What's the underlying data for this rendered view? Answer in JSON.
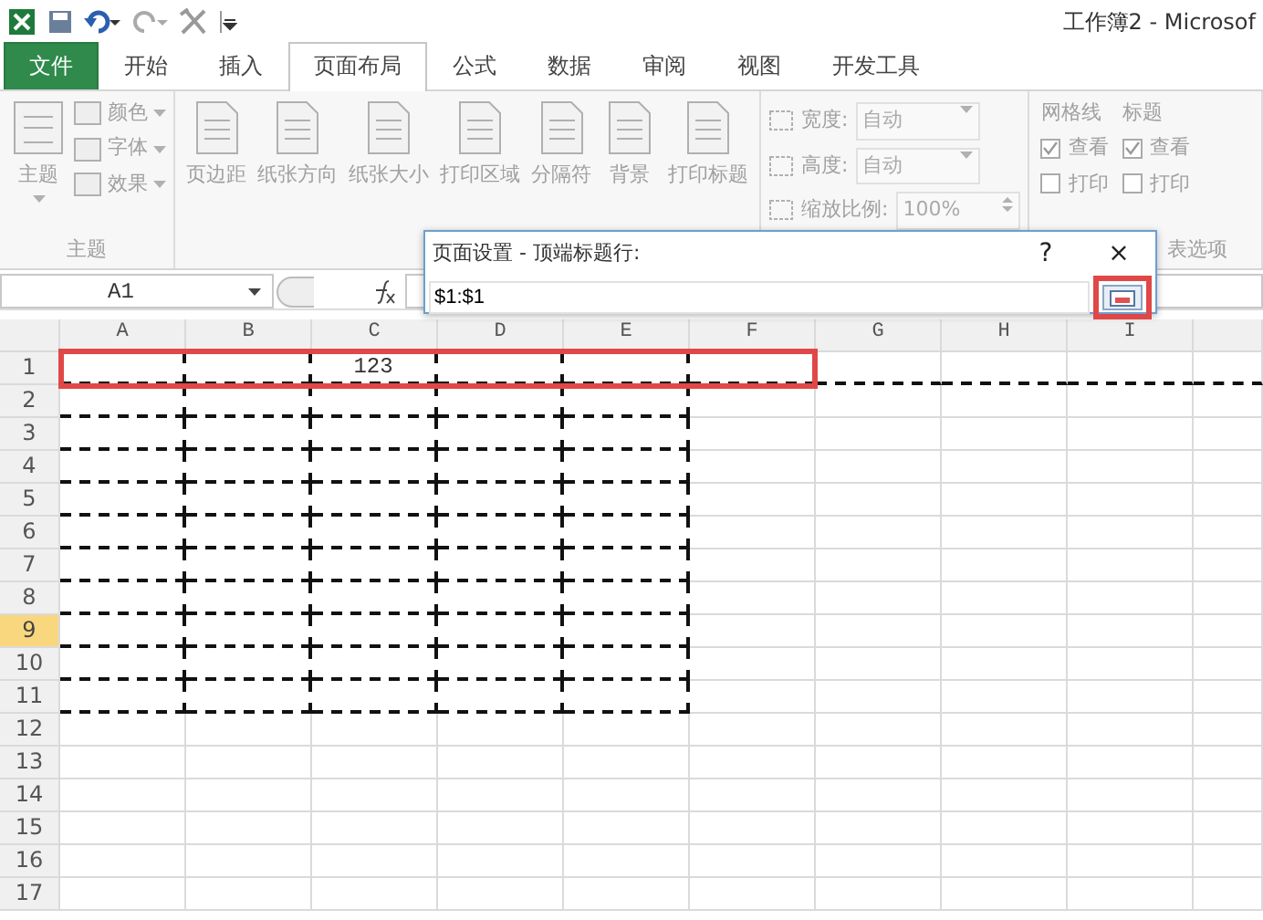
{
  "window": {
    "title": "工作簿2 - Microsof"
  },
  "tabs": [
    {
      "label": "文件",
      "kind": "file",
      "selected": false
    },
    {
      "label": "开始",
      "kind": "tab",
      "selected": false
    },
    {
      "label": "插入",
      "kind": "tab",
      "selected": false
    },
    {
      "label": "页面布局",
      "kind": "tab",
      "selected": true
    },
    {
      "label": "公式",
      "kind": "tab",
      "selected": false
    },
    {
      "label": "数据",
      "kind": "tab",
      "selected": false
    },
    {
      "label": "审阅",
      "kind": "tab",
      "selected": false
    },
    {
      "label": "视图",
      "kind": "tab",
      "selected": false
    },
    {
      "label": "开发工具",
      "kind": "tab",
      "selected": false
    }
  ],
  "ribbon": {
    "disabled": true,
    "groups": [
      {
        "kind": "theme",
        "label": "主题",
        "items": [
          {
            "kind": "large",
            "label": "主题"
          },
          {
            "kind": "small",
            "label": "颜色"
          },
          {
            "kind": "small",
            "label": "字体"
          },
          {
            "kind": "small",
            "label": "效果"
          }
        ]
      },
      {
        "kind": "buttons",
        "items": [
          {
            "label": "页边距"
          },
          {
            "label": "纸张方向"
          },
          {
            "label": "纸张大小"
          },
          {
            "label": "打印区域"
          },
          {
            "label": "分隔符"
          },
          {
            "label": "背景"
          },
          {
            "label": "打印标题"
          }
        ]
      },
      {
        "kind": "scale",
        "items": [
          {
            "kind": "dropdown",
            "label": "宽度:",
            "value": "自动"
          },
          {
            "kind": "dropdown",
            "label": "高度:",
            "value": "自动"
          },
          {
            "kind": "spinner",
            "label": "缩放比例:",
            "value": "100%"
          }
        ]
      },
      {
        "kind": "options",
        "label": "表选项",
        "columns": [
          {
            "heading": "网格线",
            "options": [
              {
                "label": "查看",
                "checked": true
              },
              {
                "label": "打印",
                "checked": false
              }
            ]
          },
          {
            "heading": "标题",
            "options": [
              {
                "label": "查看",
                "checked": true
              },
              {
                "label": "打印",
                "checked": false
              }
            ]
          }
        ]
      }
    ]
  },
  "formula_bar": {
    "name_box": "A1"
  },
  "dialog": {
    "title": "页面设置 - 顶端标题行:",
    "help": "?",
    "close": "×",
    "value": "$1:$1",
    "collapse_highlighted": true
  },
  "sheet": {
    "columns": [
      "A",
      "B",
      "C",
      "D",
      "E",
      "F",
      "G",
      "H",
      "I"
    ],
    "rows": [
      {
        "label": "1",
        "selected": false,
        "highlighted": true,
        "print_area": true,
        "cells": [
          null,
          null,
          "123"
        ]
      },
      {
        "label": "2",
        "selected": false,
        "highlighted": false,
        "print_area": true
      },
      {
        "label": "3",
        "selected": false,
        "highlighted": false,
        "print_area": true
      },
      {
        "label": "4",
        "selected": false,
        "highlighted": false,
        "print_area": true
      },
      {
        "label": "5",
        "selected": false,
        "highlighted": false,
        "print_area": true
      },
      {
        "label": "6",
        "selected": false,
        "highlighted": false,
        "print_area": true
      },
      {
        "label": "7",
        "selected": false,
        "highlighted": false,
        "print_area": true
      },
      {
        "label": "8",
        "selected": false,
        "highlighted": false,
        "print_area": true
      },
      {
        "label": "9",
        "selected": true,
        "highlighted": false,
        "print_area": true
      },
      {
        "label": "10",
        "selected": false,
        "highlighted": false,
        "print_area": true
      },
      {
        "label": "11",
        "selected": false,
        "highlighted": false,
        "print_area": true
      },
      {
        "label": "12",
        "selected": false,
        "highlighted": false,
        "print_area": false
      },
      {
        "label": "13",
        "selected": false,
        "highlighted": false,
        "print_area": false
      },
      {
        "label": "14",
        "selected": false,
        "highlighted": false,
        "print_area": false
      },
      {
        "label": "15",
        "selected": false,
        "highlighted": false,
        "print_area": false
      },
      {
        "label": "16",
        "selected": false,
        "highlighted": false,
        "print_area": false
      },
      {
        "label": "17",
        "selected": false,
        "highlighted": false,
        "print_area": false
      }
    ]
  }
}
